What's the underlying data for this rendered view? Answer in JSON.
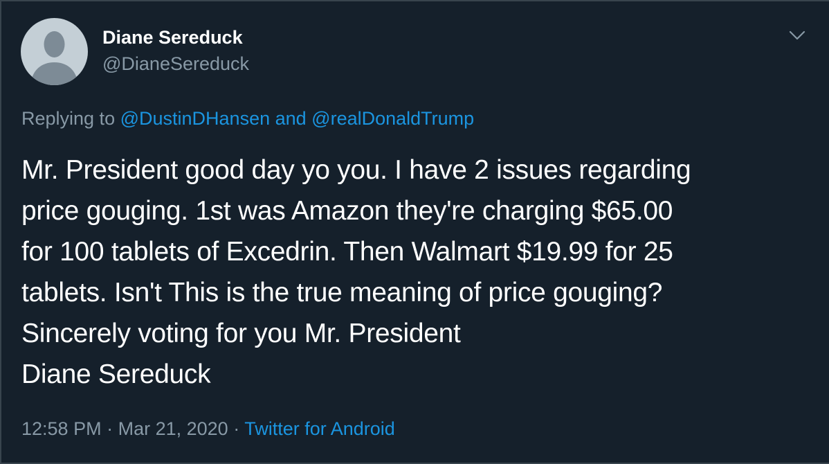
{
  "author": {
    "display_name": "Diane Sereduck",
    "handle": "@DianeSereduck",
    "avatar_icon": "default-profile-icon"
  },
  "reply": {
    "prefix": "Replying to ",
    "mention_1": "@DustinDHansen",
    "conjunction": " and ",
    "mention_2": "@realDonaldTrump"
  },
  "tweet": {
    "lines": [
      "Mr. President good day yo you. I have 2 issues regarding",
      "price gouging. 1st was Amazon they're charging $65.00",
      "for 100 tablets of Excedrin. Then Walmart $19.99 for 25",
      "tablets. Isn't This is the true meaning of price gouging?",
      "Sincerely voting for you Mr. President",
      "Diane Sereduck"
    ]
  },
  "meta": {
    "time": "12:58 PM",
    "separator": " · ",
    "date": "Mar 21, 2020",
    "source": "Twitter for Android"
  },
  "menu": {
    "icon": "chevron-down-icon"
  },
  "colors": {
    "background": "#15202b",
    "text": "#ffffff",
    "muted": "#8899a6",
    "link": "#1b95e0",
    "avatar_bg": "#c4cfd6",
    "avatar_fg": "#7d8b96"
  }
}
